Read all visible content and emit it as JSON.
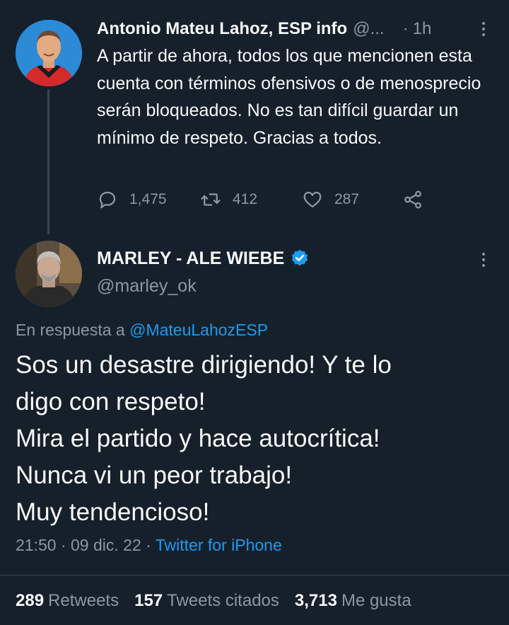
{
  "parent_tweet": {
    "name": "Antonio Mateu Lahoz, ESP info",
    "handle": "@...",
    "separator": "·",
    "time": "1h",
    "text": "A partir de ahora, todos los que mencionen esta cuenta con términos ofensivos o de menosprecio serán bloqueados. No es tan difícil guardar un mínimo de respeto. Gracias a todos.",
    "replies": "1,475",
    "retweets": "412",
    "likes": "287"
  },
  "reply_tweet": {
    "name": "MARLEY - ALE WIEBE",
    "handle": "@marley_ok",
    "in_reply_prefix": "En respuesta a ",
    "in_reply_mention": "@MateuLahozESP",
    "text_lines": [
      "Sos un desastre dirigiendo! Y te lo",
      "digo con respeto!",
      "Mira el partido y hace autocrítica!",
      "Nunca vi un peor trabajo!",
      "Muy tendencioso!"
    ],
    "timestamp": "21:50 · 09 dic. 22 · ",
    "source": "Twitter for iPhone"
  },
  "stats": [
    {
      "count": "289",
      "label": "Retweets"
    },
    {
      "count": "157",
      "label": "Tweets citados"
    },
    {
      "count": "3,713",
      "label": "Me gusta"
    }
  ],
  "icons": {
    "reply": "speech-bubble-icon",
    "retweet": "retweet-arrows-icon",
    "like": "heart-icon",
    "share": "share-nodes-icon",
    "verified": "verified-badge-icon",
    "more": "more-vertical-icon"
  },
  "colors": {
    "background": "#15202b",
    "text": "#f7f9f9",
    "secondary": "#8b98a5",
    "accent": "#1d9bf0"
  }
}
